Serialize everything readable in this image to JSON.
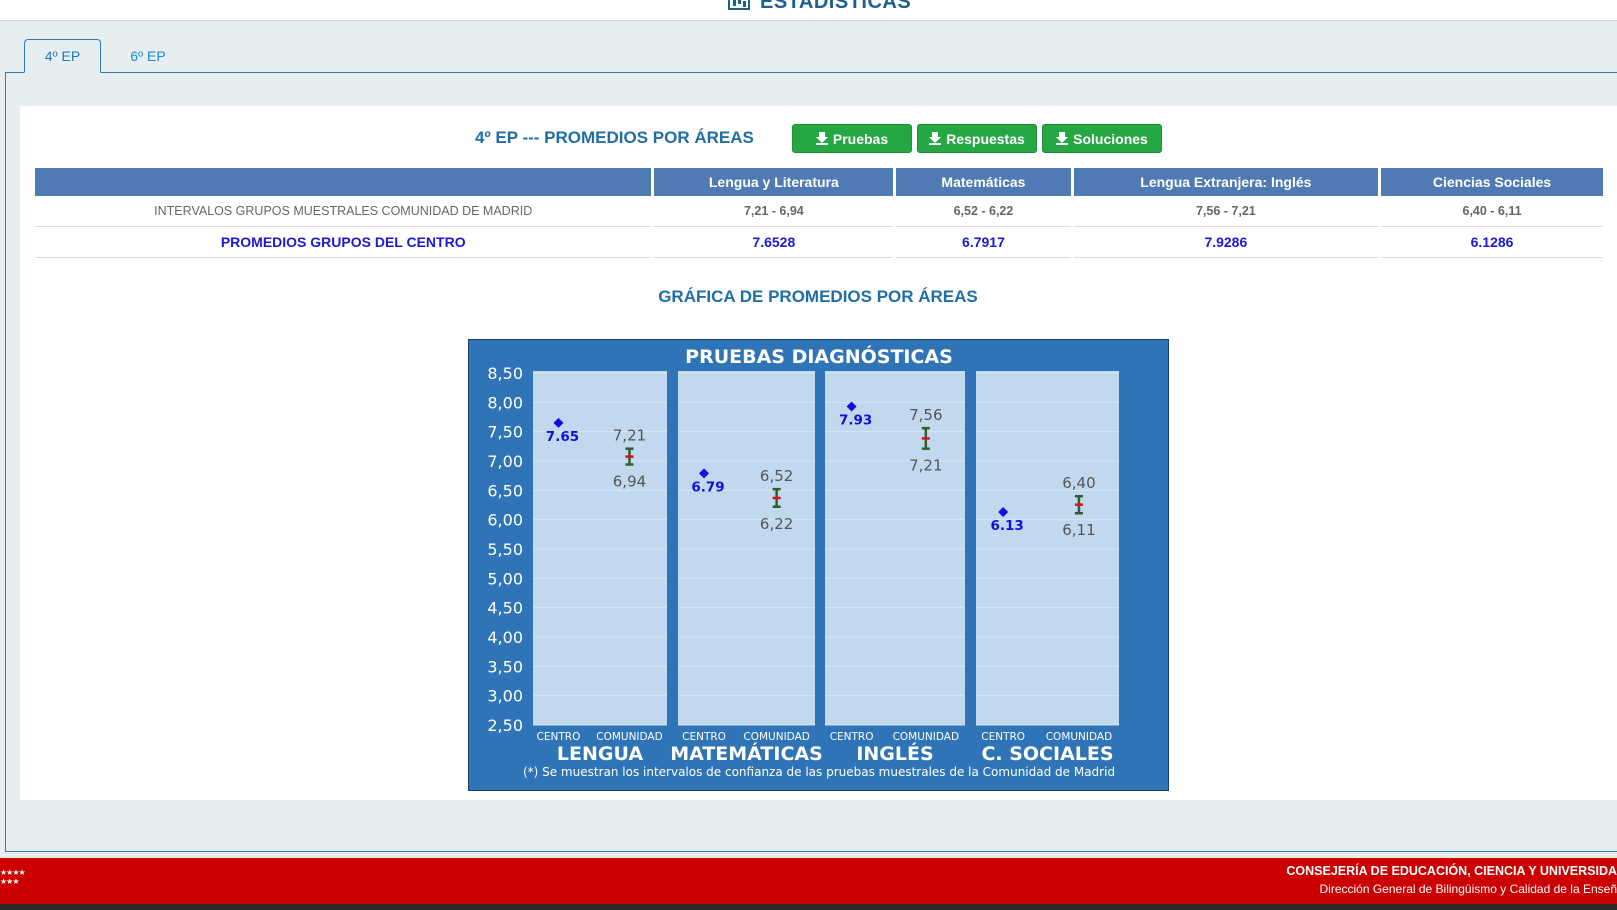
{
  "header": {
    "title": "ESTADÍSTICAS",
    "icon": "bar-chart-icon"
  },
  "tabs": [
    {
      "label": "4º EP",
      "active": true
    },
    {
      "label": "6º EP",
      "active": false
    }
  ],
  "section": {
    "title": "4º EP --- PROMEDIOS POR ÁREAS",
    "buttons": {
      "pruebas": "Pruebas",
      "respuestas": "Respuestas",
      "soluciones": "Soluciones"
    }
  },
  "table": {
    "headers": [
      "",
      "Lengua y Literatura",
      "Matemáticas",
      "Lengua Extranjera: Inglés",
      "Ciencias Sociales"
    ],
    "rows": [
      {
        "label": "INTERVALOS GRUPOS MUESTRALES COMUNIDAD DE MADRID",
        "values": [
          "7,21 - 6,94",
          "6,52 - 6,22",
          "7,56 - 7,21",
          "6,40 - 6,11"
        ]
      },
      {
        "label": "PROMEDIOS GRUPOS DEL CENTRO",
        "values": [
          "7.6528",
          "6.7917",
          "7.9286",
          "6.1286"
        ]
      }
    ]
  },
  "graph_title": "GRÁFICA DE PROMEDIOS POR ÁREAS",
  "chart_data": {
    "type": "scatter",
    "title": "PRUEBAS DIAGNÓSTICAS",
    "ylim": [
      2.5,
      8.5
    ],
    "yticks": [
      "8,50",
      "8,00",
      "7,50",
      "7,00",
      "6,50",
      "6,00",
      "5,50",
      "5,00",
      "4,50",
      "4,00",
      "3,50",
      "3,00",
      "2,50"
    ],
    "sublabels": [
      "CENTRO",
      "COMUNIDAD"
    ],
    "categories": [
      "LENGUA",
      "MATEMÁTICAS",
      "INGLÉS",
      "C. SOCIALES"
    ],
    "centro": [
      7.65,
      6.79,
      7.93,
      6.13
    ],
    "centro_labels": [
      "7.65",
      "6.79",
      "7.93",
      "6.13"
    ],
    "comunidad_high": [
      7.21,
      6.52,
      7.56,
      6.4
    ],
    "comunidad_low": [
      6.94,
      6.22,
      7.21,
      6.11
    ],
    "comunidad_high_labels": [
      "7,21",
      "6,52",
      "7,56",
      "6,40"
    ],
    "comunidad_low_labels": [
      "6,94",
      "6,22",
      "7,21",
      "6,11"
    ],
    "footnote": "(*) Se muestran los intervalos de confianza de las pruebas muestrales de la Comunidad de Madrid",
    "colors": {
      "background": "#2f74b6",
      "panel": "#c1d8ee",
      "centro": "#1010e0",
      "interval": "#2e5e2e",
      "midpoint": "#e01010"
    }
  },
  "footer": {
    "line1": "CONSEJERÍA DE EDUCACIÓN, CIENCIA Y UNIVERSIDA",
    "line2": "Dirección General de Bilingüismo y Calidad de la Enseñ",
    "stars": "★★★★\n★★★"
  }
}
